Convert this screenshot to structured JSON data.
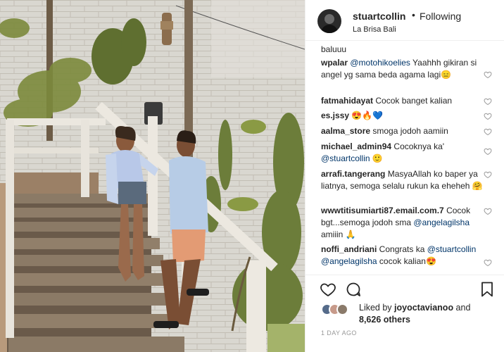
{
  "header": {
    "username": "stuartcollin",
    "separator": "•",
    "follow_status": "Following",
    "location": "La Brisa Bali"
  },
  "comments": {
    "top_fragment": "baluuu",
    "items": [
      {
        "user": "wpalar",
        "mention": "@motohikoelies",
        "text": " Yaahhh gikiran si angel yg sama beda agama lagi😑",
        "mention2": "",
        "tail": ""
      },
      {
        "user": "fatmahidayat",
        "mention": "",
        "text": " Cocok banget kalian",
        "mention2": "",
        "tail": ""
      },
      {
        "user": "es.jssy",
        "mention": "",
        "text": " 😍🔥💙",
        "mention2": "",
        "tail": ""
      },
      {
        "user": "aalma_store",
        "mention": "",
        "text": " smoga jodoh aamiin",
        "mention2": "",
        "tail": ""
      },
      {
        "user": "michael_admin94",
        "mention": "",
        "text": " Cocoknya ka' ",
        "mention2": "@stuartcollin",
        "tail": " 🙂"
      },
      {
        "user": "arrafi.tangerang",
        "mention": "",
        "text": " MasyaAllah ko baper ya liatnya, semoga selalu rukun ka eheheh 🤗",
        "mention2": "",
        "tail": ""
      },
      {
        "user": "wwwtitisumiarti87.email.com.7",
        "mention": "",
        "text": " Cocok bgt...semoga jodoh sma ",
        "mention2": "@angelagilsha",
        "tail": " amiiin 🙏"
      },
      {
        "user": "noffi_andriani",
        "mention": "",
        "text": " Congrats ka ",
        "mention2": "@stuartcollin @angelagilsha",
        "tail": " cocok kalian😍"
      }
    ]
  },
  "likes": {
    "prefix": "Liked by ",
    "user": "joyoctavianoo",
    "and": " and",
    "count": "8,626 others"
  },
  "timestamp": "1 DAY AGO",
  "colors": {
    "text": "#262626",
    "mention": "#003569",
    "muted": "#999999",
    "border": "#efefef"
  },
  "icons": {
    "comment_heart": "heart-outline-icon",
    "like": "heart-outline-icon",
    "comment": "speech-bubble-icon",
    "share": "paper-plane-icon",
    "save": "bookmark-icon"
  }
}
